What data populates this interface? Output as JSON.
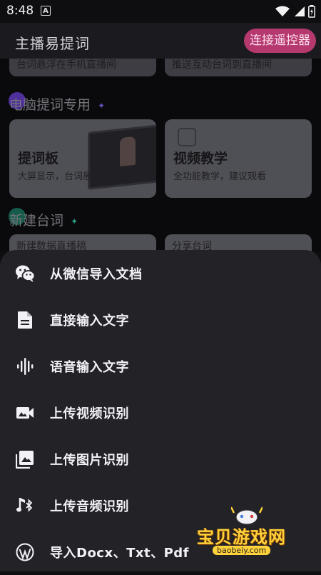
{
  "status_bar": {
    "time": "8:48",
    "notification_glyph": "A"
  },
  "header": {
    "title": "主播易提词",
    "remote_button": "连接遥控器",
    "accent": "#b5396e"
  },
  "background": {
    "top_cards": [
      "台词悬浮在手机直播间",
      "推送互动台词到直播间"
    ],
    "sections": [
      {
        "label": "电脑提词专用",
        "dot_color": "#6a3fd0",
        "sparkle_color": "#8a6cff"
      },
      {
        "label": "新建台词",
        "dot_color": "#1f7a66",
        "sparkle_color": "#3fd0b0"
      }
    ],
    "cards": [
      {
        "title": "提词板",
        "subtitle": "大屏显示，台词展示"
      },
      {
        "title": "视频教学",
        "subtitle": "全功能教学，建议观看"
      }
    ],
    "bottom_cards": [
      "新建数据直播稿",
      "分享台词"
    ]
  },
  "sheet": {
    "items": [
      {
        "label": "从微信导入文档",
        "icon": "wechat-icon"
      },
      {
        "label": "直接输入文字",
        "icon": "document-icon"
      },
      {
        "label": "语音输入文字",
        "icon": "voice-wave-icon"
      },
      {
        "label": "上传视频识别",
        "icon": "video-camera-icon"
      },
      {
        "label": "上传图片识别",
        "icon": "image-library-icon"
      },
      {
        "label": "上传音频识别",
        "icon": "bluetooth-audio-icon"
      },
      {
        "label": "导入Docx、Txt、Pdf",
        "icon": "wordpress-icon"
      }
    ]
  },
  "watermark": {
    "text": "宝贝游戏网",
    "url": "baobeiy.com"
  }
}
